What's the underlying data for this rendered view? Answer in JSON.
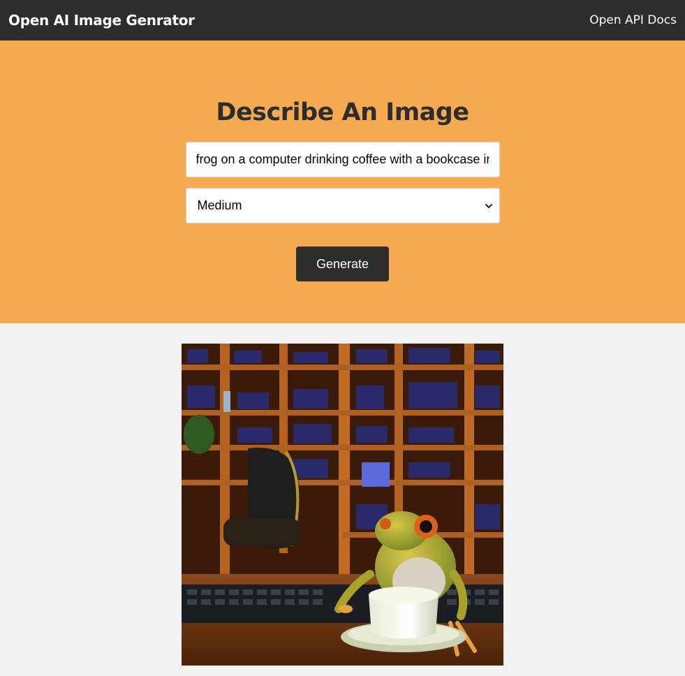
{
  "header": {
    "logo": "Open AI Image Genrator",
    "docs_link": "Open API Docs"
  },
  "form": {
    "title": "Describe An Image",
    "prompt_value": "frog on a computer drinking coffee with a bookcase in the background",
    "size_selected": "Medium",
    "generate_label": "Generate"
  },
  "colors": {
    "navbar": "#2d2d2d",
    "hero": "#f6ab51",
    "button": "#2d2d2d",
    "page_background": "#f2f2f2"
  },
  "icons": {
    "select_arrow": "chevron-down-icon"
  }
}
